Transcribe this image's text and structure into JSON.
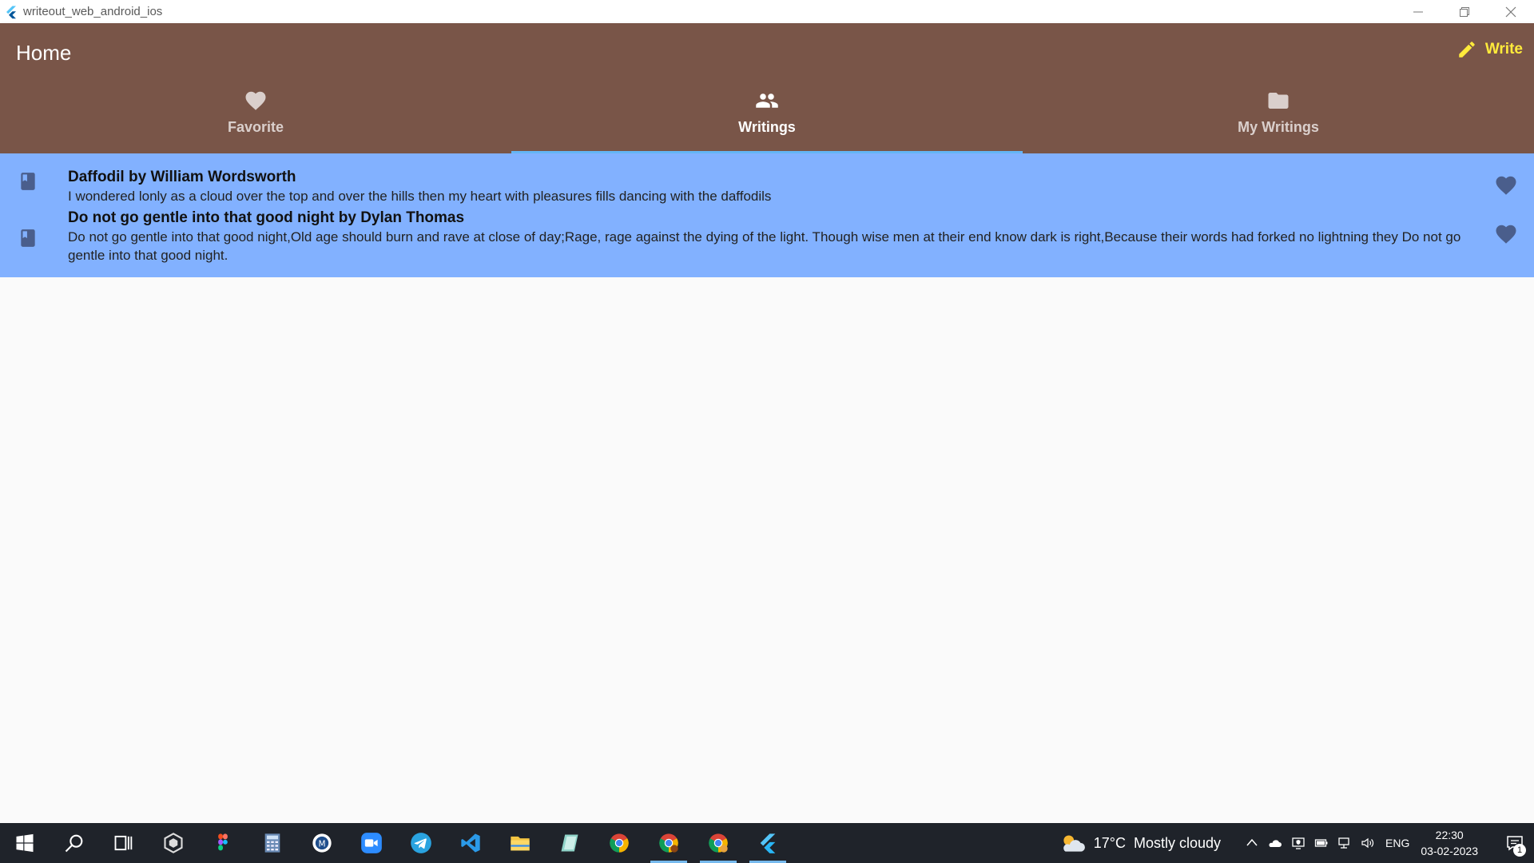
{
  "window": {
    "title": "writeout_web_android_ios"
  },
  "appbar": {
    "title": "Home",
    "write_label": "Write",
    "colors": {
      "background": "#795548",
      "write": "#ffeb3b",
      "indicator": "#64b5f6"
    }
  },
  "tabs": [
    {
      "label": "Favorite",
      "icon": "heart-icon",
      "active": false
    },
    {
      "label": "Writings",
      "icon": "people-icon",
      "active": true
    },
    {
      "label": "My Writings",
      "icon": "folder-icon",
      "active": false
    }
  ],
  "writings": [
    {
      "title": "Daffodil by William Wordsworth",
      "excerpt": "I wondered lonly as a cloud over the top and over the hills then my heart with pleasures fills dancing with the daffodils"
    },
    {
      "title": "Do not go gentle into that good night by Dylan Thomas",
      "excerpt": "Do not go gentle into that good night,Old age should burn and rave at close of day;Rage, rage against the dying of the light. Though wise men at their end know dark is right,Because their words had forked no lightning they Do not go gentle into that good night."
    }
  ],
  "taskbar": {
    "weather": {
      "temp": "17°C",
      "condition": "Mostly cloudy"
    },
    "language": "ENG",
    "time": "22:30",
    "date": "03-02-2023",
    "notification_count": "1"
  }
}
